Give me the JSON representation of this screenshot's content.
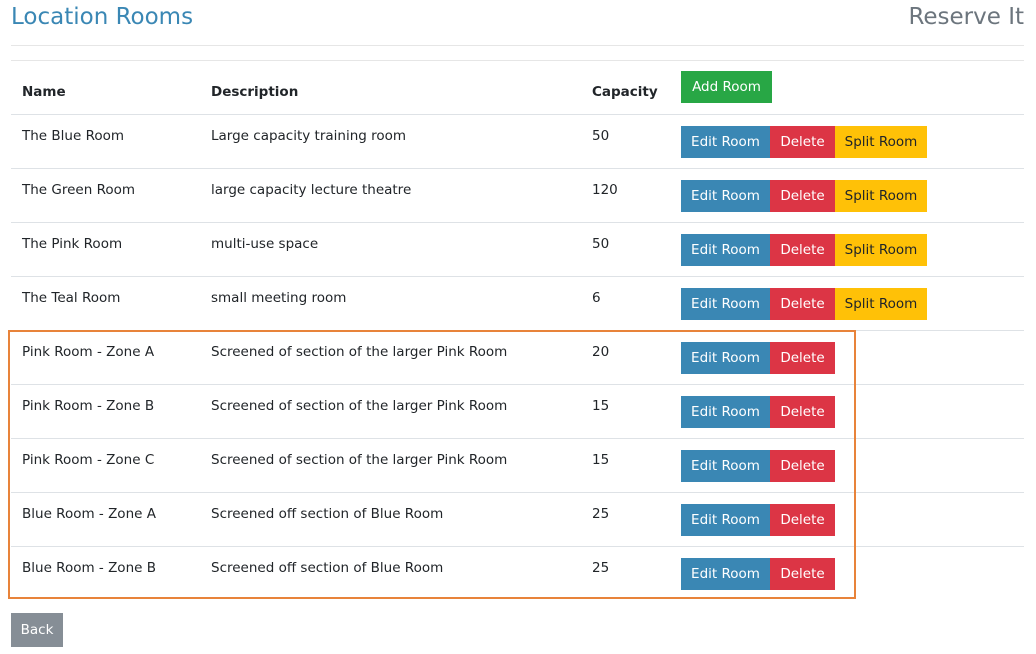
{
  "header": {
    "title": "Location Rooms",
    "brand": "Reserve It"
  },
  "table": {
    "columns": {
      "name": "Name",
      "description": "Description",
      "capacity": "Capacity"
    },
    "add_label": "Add Room",
    "actions": {
      "edit_label": "Edit Room",
      "delete_label": "Delete",
      "split_label": "Split Room"
    },
    "rows": [
      {
        "name": "The Blue Room",
        "description": "Large capacity training room",
        "capacity": "50",
        "splittable": true
      },
      {
        "name": "The Green Room",
        "description": "large capacity lecture theatre",
        "capacity": "120",
        "splittable": true
      },
      {
        "name": "The Pink Room",
        "description": "multi-use space",
        "capacity": "50",
        "splittable": true
      },
      {
        "name": "The Teal Room",
        "description": "small meeting room",
        "capacity": "6",
        "splittable": true
      },
      {
        "name": "Pink Room - Zone A",
        "description": "Screened of section of the larger Pink Room",
        "capacity": "20",
        "splittable": false
      },
      {
        "name": "Pink Room - Zone B",
        "description": "Screened of section of the larger Pink Room",
        "capacity": "15",
        "splittable": false
      },
      {
        "name": "Pink Room - Zone C",
        "description": "Screened of section of the larger Pink Room",
        "capacity": "15",
        "splittable": false
      },
      {
        "name": "Blue Room - Zone A",
        "description": "Screened off section of Blue Room",
        "capacity": "25",
        "splittable": false
      },
      {
        "name": "Blue Room - Zone B",
        "description": "Screened off section of Blue Room",
        "capacity": "25",
        "splittable": false
      }
    ]
  },
  "footer": {
    "back_label": "Back"
  },
  "colors": {
    "primary": "#3a87b4",
    "danger": "#dc3545",
    "warning": "#ffc107",
    "success": "#28a745",
    "secondary": "#868e96",
    "highlight": "#e8833a"
  }
}
